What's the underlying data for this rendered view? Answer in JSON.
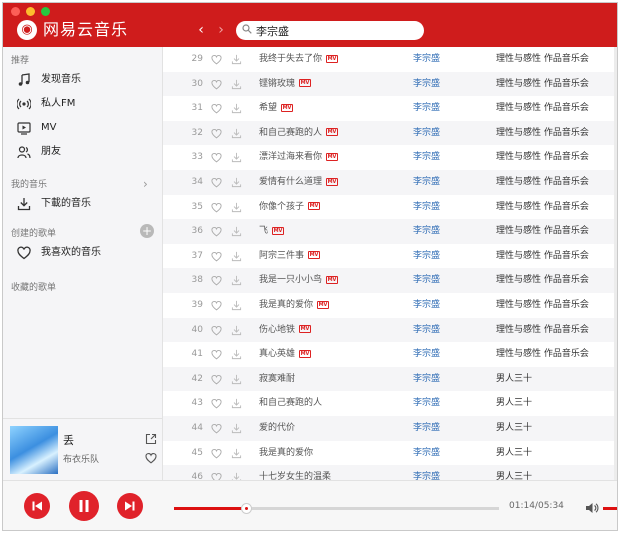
{
  "window": {
    "app_title": "网易云音乐",
    "search": {
      "value": "李宗盛",
      "placeholder": ""
    }
  },
  "colors": {
    "brand": "#cf1c1c",
    "artist_link": "#2f6cb5",
    "progress": "#dd1111"
  },
  "sidebar": {
    "sections": [
      {
        "title": "推荐",
        "items": [
          {
            "label": "发现音乐",
            "icon": "music-note-icon"
          },
          {
            "label": "私人FM",
            "icon": "radio-icon"
          },
          {
            "label": "MV",
            "icon": "video-icon"
          },
          {
            "label": "朋友",
            "icon": "friends-icon"
          }
        ]
      },
      {
        "title": "我的音乐",
        "items": [
          {
            "label": "下載的音乐",
            "icon": "download-icon"
          }
        ]
      },
      {
        "title": "创建的歌单",
        "items": [
          {
            "label": "我喜欢的音乐",
            "icon": "heart-icon"
          }
        ]
      },
      {
        "title": "收藏的歌单",
        "items": []
      }
    ]
  },
  "now_playing": {
    "title": "丢",
    "artist": "布衣乐队"
  },
  "tracks": [
    {
      "num": "29",
      "title": "我终于失去了你",
      "mv": true,
      "artist": "李宗盛",
      "album": "理性与感性 作品音乐会"
    },
    {
      "num": "30",
      "title": "铿锵玫瑰",
      "mv": true,
      "artist": "李宗盛",
      "album": "理性与感性 作品音乐会"
    },
    {
      "num": "31",
      "title": "希望",
      "mv": true,
      "artist": "李宗盛",
      "album": "理性与感性 作品音乐会"
    },
    {
      "num": "32",
      "title": "和自己赛跑的人",
      "mv": true,
      "artist": "李宗盛",
      "album": "理性与感性 作品音乐会"
    },
    {
      "num": "33",
      "title": "漂洋过海来看你",
      "mv": true,
      "artist": "李宗盛",
      "album": "理性与感性 作品音乐会"
    },
    {
      "num": "34",
      "title": "爱情有什么道理",
      "mv": true,
      "artist": "李宗盛",
      "album": "理性与感性 作品音乐会"
    },
    {
      "num": "35",
      "title": "你像个孩子",
      "mv": true,
      "artist": "李宗盛",
      "album": "理性与感性 作品音乐会"
    },
    {
      "num": "36",
      "title": "飞",
      "mv": true,
      "artist": "李宗盛",
      "album": "理性与感性 作品音乐会"
    },
    {
      "num": "37",
      "title": "阿宗三件事",
      "mv": true,
      "artist": "李宗盛",
      "album": "理性与感性 作品音乐会"
    },
    {
      "num": "38",
      "title": "我是一只小小鸟",
      "mv": true,
      "artist": "李宗盛",
      "album": "理性与感性 作品音乐会"
    },
    {
      "num": "39",
      "title": "我是真的爱你",
      "mv": true,
      "artist": "李宗盛",
      "album": "理性与感性 作品音乐会"
    },
    {
      "num": "40",
      "title": "伤心地铁",
      "mv": true,
      "artist": "李宗盛",
      "album": "理性与感性 作品音乐会"
    },
    {
      "num": "41",
      "title": "真心英雄",
      "mv": true,
      "artist": "李宗盛",
      "album": "理性与感性 作品音乐会"
    },
    {
      "num": "42",
      "title": "寂寞难耐",
      "mv": false,
      "artist": "李宗盛",
      "album": "男人三十"
    },
    {
      "num": "43",
      "title": "和自己赛跑的人",
      "mv": false,
      "artist": "李宗盛",
      "album": "男人三十"
    },
    {
      "num": "44",
      "title": "爱的代价",
      "mv": false,
      "artist": "李宗盛",
      "album": "男人三十"
    },
    {
      "num": "45",
      "title": "我是真的爱你",
      "mv": false,
      "artist": "李宗盛",
      "album": "男人三十"
    },
    {
      "num": "46",
      "title": "十七岁女生的温柔",
      "mv": false,
      "artist": "李宗盛",
      "album": "男人三十"
    }
  ],
  "mv_badge": "MV",
  "player": {
    "current_time": "01:14",
    "total_time": "05:34",
    "time_display": "01:14/05:34",
    "progress_fraction": 0.22
  }
}
